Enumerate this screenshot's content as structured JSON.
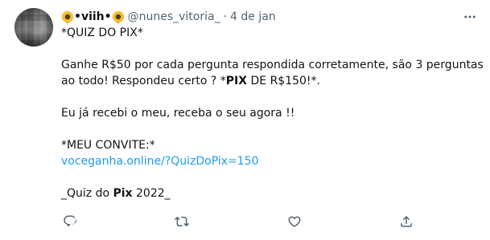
{
  "tweet": {
    "author": {
      "emoji_before": "🌻",
      "display_name": "•viih•",
      "emoji_after": "🌻",
      "handle": "@nunes_vitoria_",
      "separator": "·",
      "date": "4 de jan"
    },
    "lines": {
      "title": "*QUIZ DO PIX*",
      "p1_line1": "Ganhe R$50 por cada pergunta respondida corretamente, são 3 perguntas",
      "p1_line2_a": "ao todo! Respondeu certo ? *",
      "p1_line2_b": "PIX",
      "p1_line2_c": " DE R$150!*.",
      "p2": "Eu já recebi o meu, receba o seu agora !!",
      "invite_label": "*MEU CONVITE:*",
      "link": "voceganha.online/?QuizDoPix=150",
      "footer_a": "_Quiz do ",
      "footer_b": "Pix",
      "footer_c": " 2022_"
    },
    "actions": {
      "reply_icon": "reply-icon",
      "retweet_icon": "retweet-icon",
      "like_icon": "heart-icon",
      "share_icon": "share-icon"
    }
  },
  "colors": {
    "text": "#0f1419",
    "secondary": "#536471",
    "link": "#1d9bf0"
  }
}
